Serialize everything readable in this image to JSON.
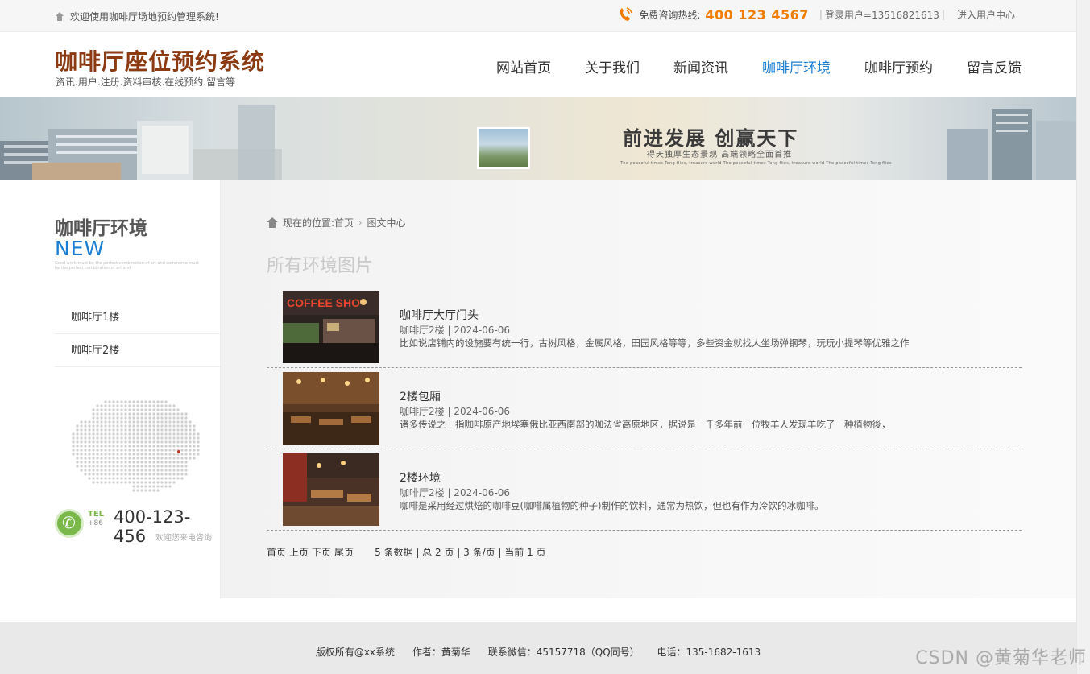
{
  "topbar": {
    "welcome": "欢迎使用咖啡厅场地预约管理系统!",
    "hotline_label": "免费咨询热线:",
    "hotline": "400 123 4567",
    "login_user": "登录用户=13516821613",
    "separator": "|",
    "user_center": "进入用户中心"
  },
  "header": {
    "title": "咖啡厅座位预约系统",
    "subtitle": "资讯.用户.注册.资料审核.在线预约.留言等",
    "nav": [
      {
        "label": "网站首页"
      },
      {
        "label": "关于我们"
      },
      {
        "label": "新闻资讯"
      },
      {
        "label": "咖啡厅环境",
        "active": true
      },
      {
        "label": "咖啡厅预约"
      },
      {
        "label": "留言反馈"
      }
    ]
  },
  "banner": {
    "slogan": "前进发展 创赢天下",
    "slogan_sub": "得天独厚生态景观 高端领略全面首推",
    "tiny_text": "The peaceful times Teng flies, treasure world The peaceful times Teng flies, treasure world The peaceful times Teng flies"
  },
  "sidebar": {
    "title": "咖啡厅环境",
    "new_label": "NEW",
    "tiny_text": "Good work must be the perfect combination of art and commerce must be the perfect combination of art and",
    "menu": [
      {
        "label": "咖啡厅1楼"
      },
      {
        "label": "咖啡厅2楼"
      }
    ],
    "tel_label": "TEL",
    "tel_code": "+86",
    "tel_number": "400-123-456",
    "tel_hint": "欢迎您来电咨询"
  },
  "content": {
    "breadcrumb_prefix": "现在的位置:",
    "breadcrumb_home": "首页",
    "breadcrumb_current": "图文中心",
    "section_title": "所有环境图片",
    "items": [
      {
        "title": "咖啡厅大厅门头",
        "meta": "咖啡厅2楼 | 2024-06-06",
        "desc": "比如说店铺内的设施要有统一行，古树风格，金属风格，田园风格等等，多些资金就找人坐场弹钢琴，玩玩小提琴等优雅之作"
      },
      {
        "title": "2楼包厢",
        "meta": "咖啡厅2楼 | 2024-06-06",
        "desc": "诸多传说之一指咖啡原产地埃塞俄比亚西南部的咖法省高原地区，据说是一千多年前一位牧羊人发现羊吃了一种植物後，"
      },
      {
        "title": "2楼环境",
        "meta": "咖啡厅2楼 | 2024-06-06",
        "desc": "咖啡是采用经过烘焙的咖啡豆(咖啡属植物的种子)制作的饮料，通常为热饮，但也有作为冷饮的冰咖啡。"
      }
    ],
    "pager": {
      "first": "首页",
      "prev": "上页",
      "next": "下页",
      "last": "尾页",
      "info": "5 条数据 | 总 2 页 | 3 条/页 | 当前 1 页"
    }
  },
  "footer": {
    "copyright": "版权所有@xx系统",
    "author": "作者：黄菊华",
    "wechat": "联系微信：45157718（QQ同号）",
    "phone": "电话：135-1682-1613"
  },
  "watermark": "CSDN @黄菊华老师",
  "colors": {
    "brand_title": "#8b3a12",
    "nav_active": "#1a7fd4",
    "hotline": "#f07c00",
    "tel_green": "#7ab84a"
  }
}
